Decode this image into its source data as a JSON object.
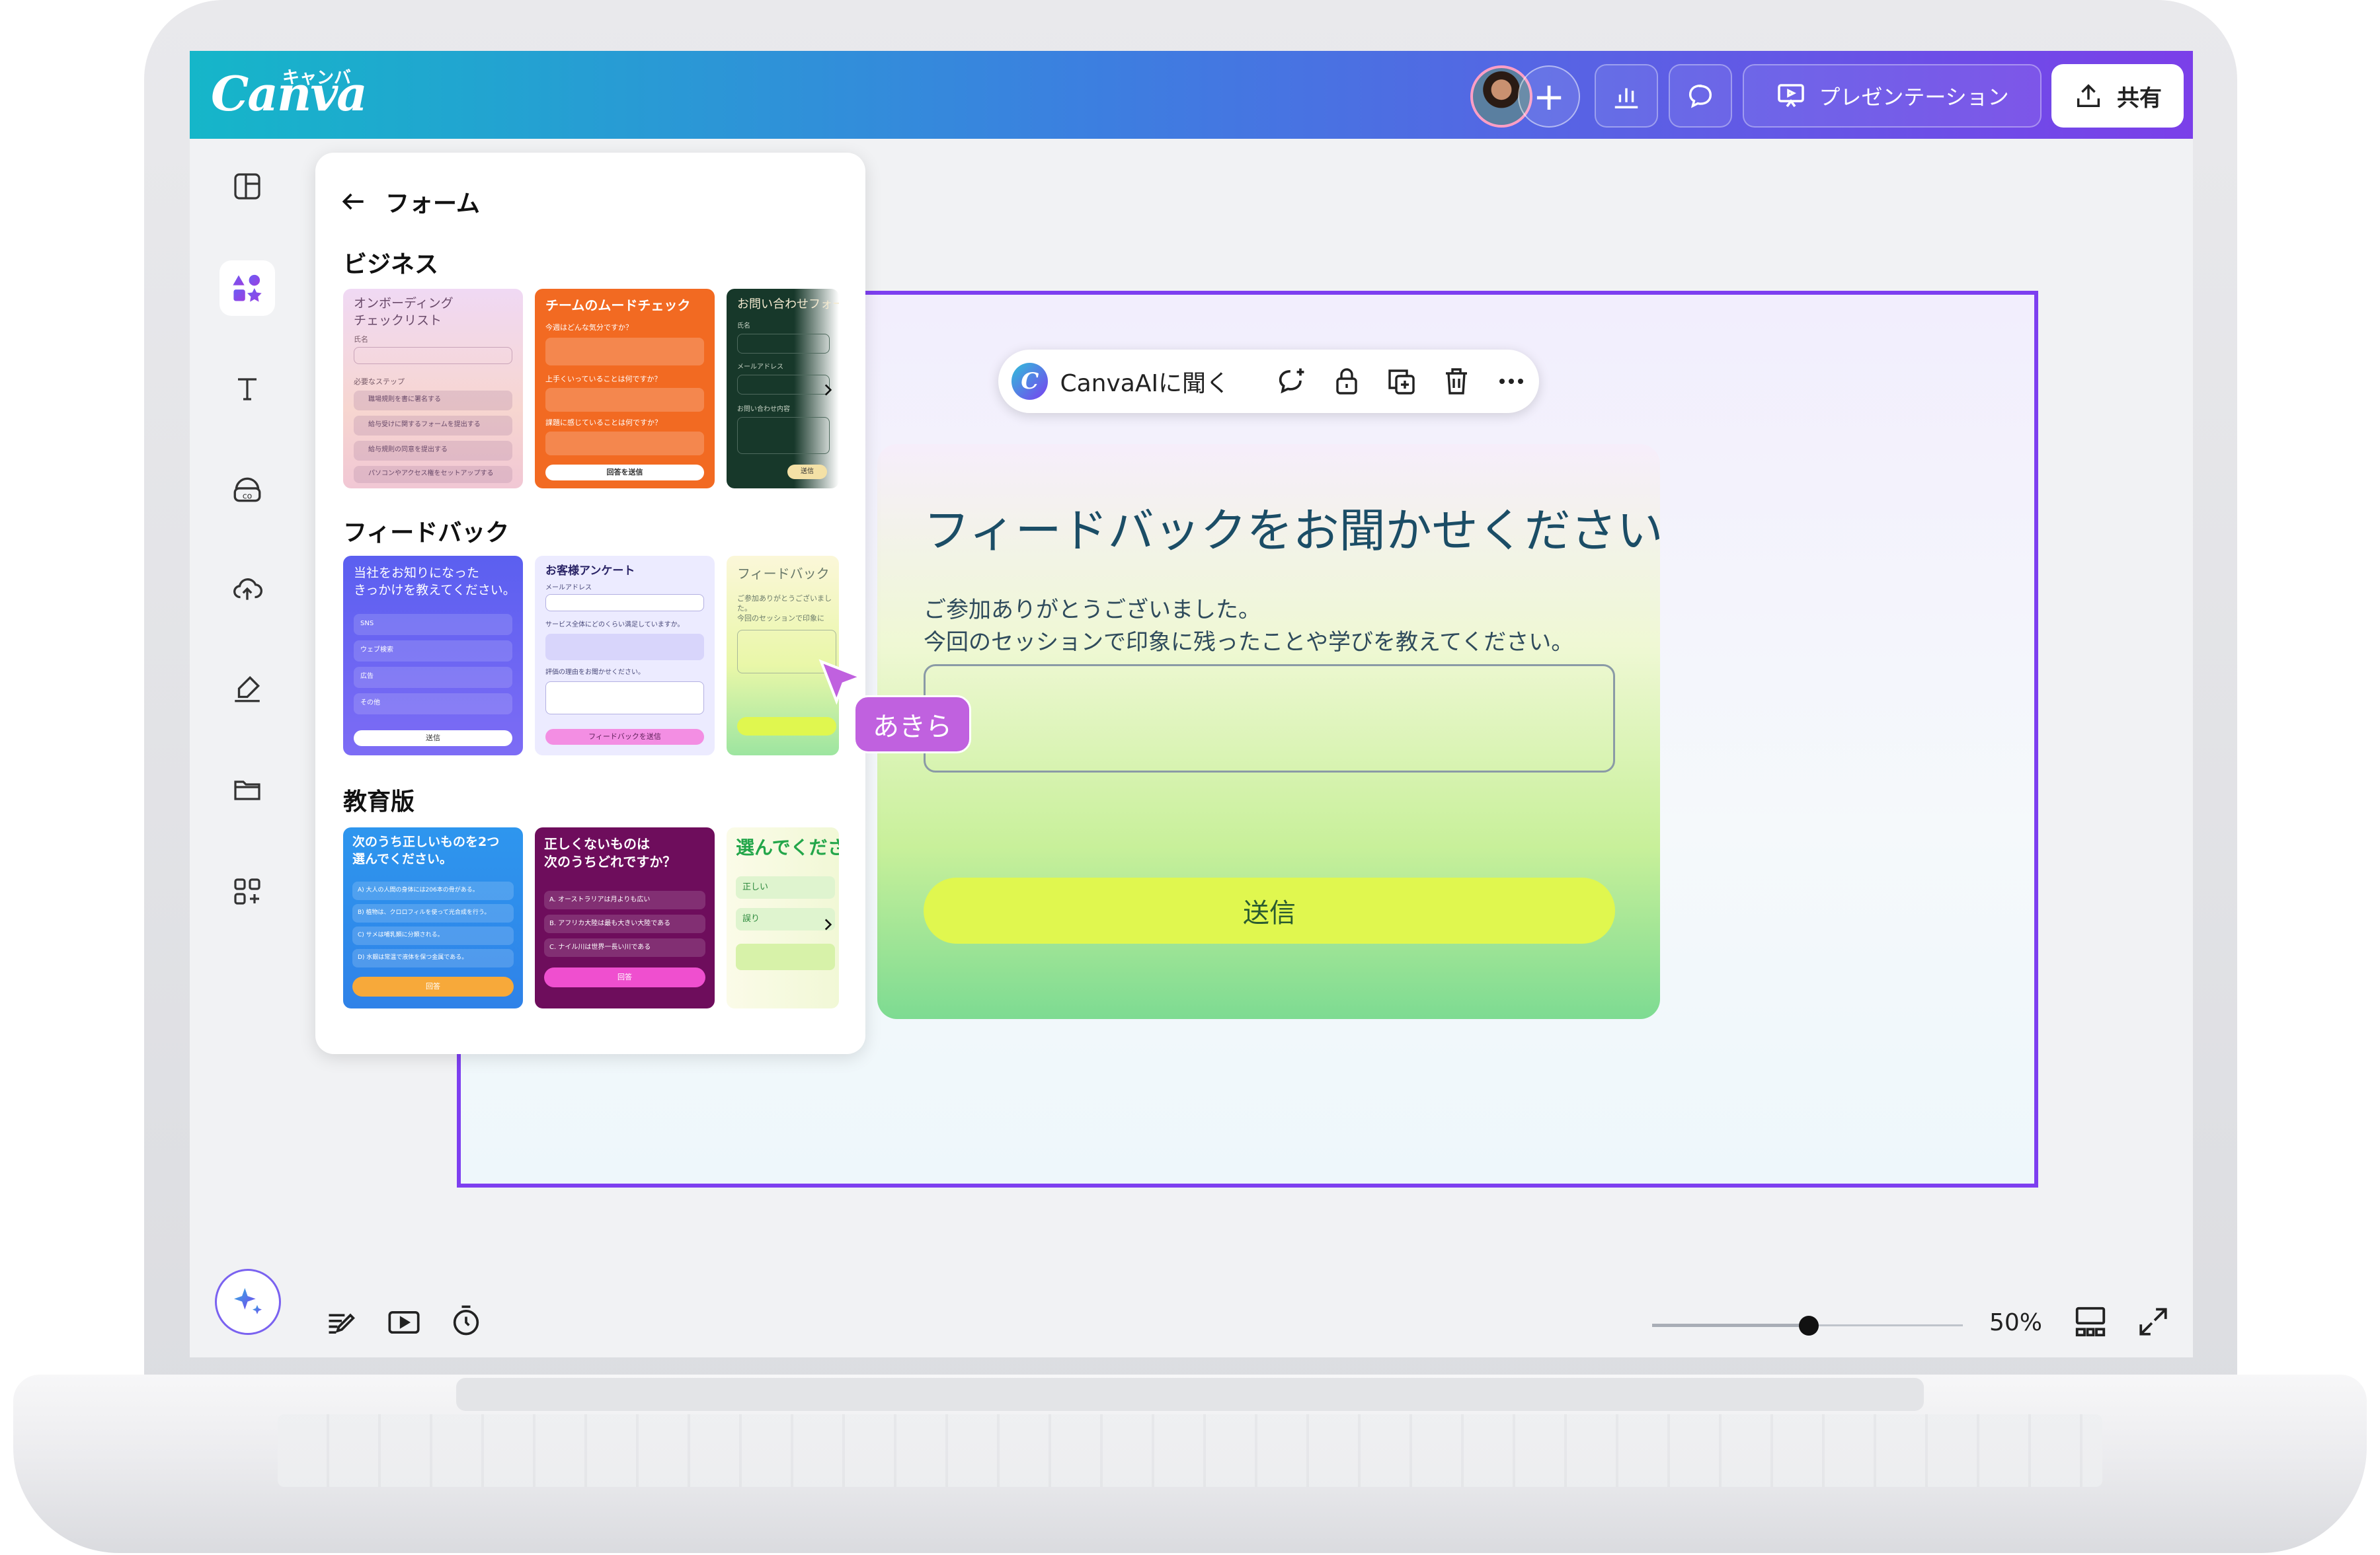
{
  "app": {
    "logo": "Canva",
    "logo_kana": "キャンバ"
  },
  "header": {
    "add_label": "+",
    "present_label": "プレゼンテーション",
    "share_label": "共有"
  },
  "panel": {
    "title": "フォーム",
    "sections": {
      "business": "ビジネス",
      "feedback": "フィードバック",
      "education": "教育版"
    },
    "templates": {
      "onboarding": {
        "title": "オンボーディング\nチェックリスト",
        "field1": "氏名",
        "field2": "必要なステップ",
        "items": [
          "職場規則を書に署名する",
          "給与受けに関するフォームを提出する",
          "給与規則の同意を提出する",
          "パソコンやアクセス権をセットアップする"
        ]
      },
      "mood": {
        "title": "チームのムードチェック",
        "q1": "今週はどんな気分ですか？",
        "q2": "上手くいっていることは何ですか？",
        "q3": "課題に感じていることは何ですか？",
        "submit": "回答を送信"
      },
      "contact": {
        "title": "お問い合わせフォーム",
        "f1": "氏名",
        "f2": "メールアドレス",
        "f3": "お問い合わせ内容",
        "submit": "送信"
      },
      "how_did_you_know": {
        "title": "当社をお知りになった\nきっかけを教えてください。",
        "options": [
          "SNS",
          "ウェブ検索",
          "広告",
          "その他"
        ],
        "submit": "送信"
      },
      "survey": {
        "title": "お客様アンケート",
        "f1": "メールアドレス",
        "q1": "サービス全体にどのくらい満足していますか。",
        "q2": "評価の理由をお聞かせください。",
        "submit": "フィードバックを送信"
      },
      "feedback_mini": {
        "title": "フィードバック",
        "desc": "ご参加ありがとうございました。\n今回のセッションで印象に"
      },
      "quiz1": {
        "title": "次のうち正しいものを2つ\n選んでください。",
        "options": [
          "A) 大人の人間の身体には206本の骨がある。",
          "B) 植物は、クロロフィルを使って光合成を行う。",
          "C) サメは哺乳類に分類される。",
          "D) 水銀は常温で液体を保つ金属である。"
        ],
        "submit": "回答"
      },
      "quiz2": {
        "title": "正しくないものは\n次のうちどれですか？",
        "options": [
          "A. オーストラリアは月よりも広い",
          "B. アフリカ大陸は最も大きい大陸である",
          "C. ナイル川は世界一長い川である"
        ],
        "submit": "回答"
      },
      "quiz3": {
        "title": "選んでくださ",
        "options": [
          "正しい",
          "誤り"
        ]
      }
    }
  },
  "toolbar": {
    "ai_label": "CanvaAIに聞く"
  },
  "form": {
    "title": "フィードバックをお聞かせください",
    "desc_line1": "ご参加ありがとうございました。",
    "desc_line2": "今回のセッションで印象に残ったことや学びを教えてください。",
    "submit": "送信"
  },
  "collaborator": {
    "name": "あきら"
  },
  "footer": {
    "zoom": "50%",
    "zoom_level": 0.5
  },
  "colors": {
    "accent_purple": "#7d3ff0",
    "header_start": "#15b6c9",
    "header_end": "#7b3fe9",
    "cursor": "#c061df",
    "submit_lime": "#e0f74f"
  }
}
